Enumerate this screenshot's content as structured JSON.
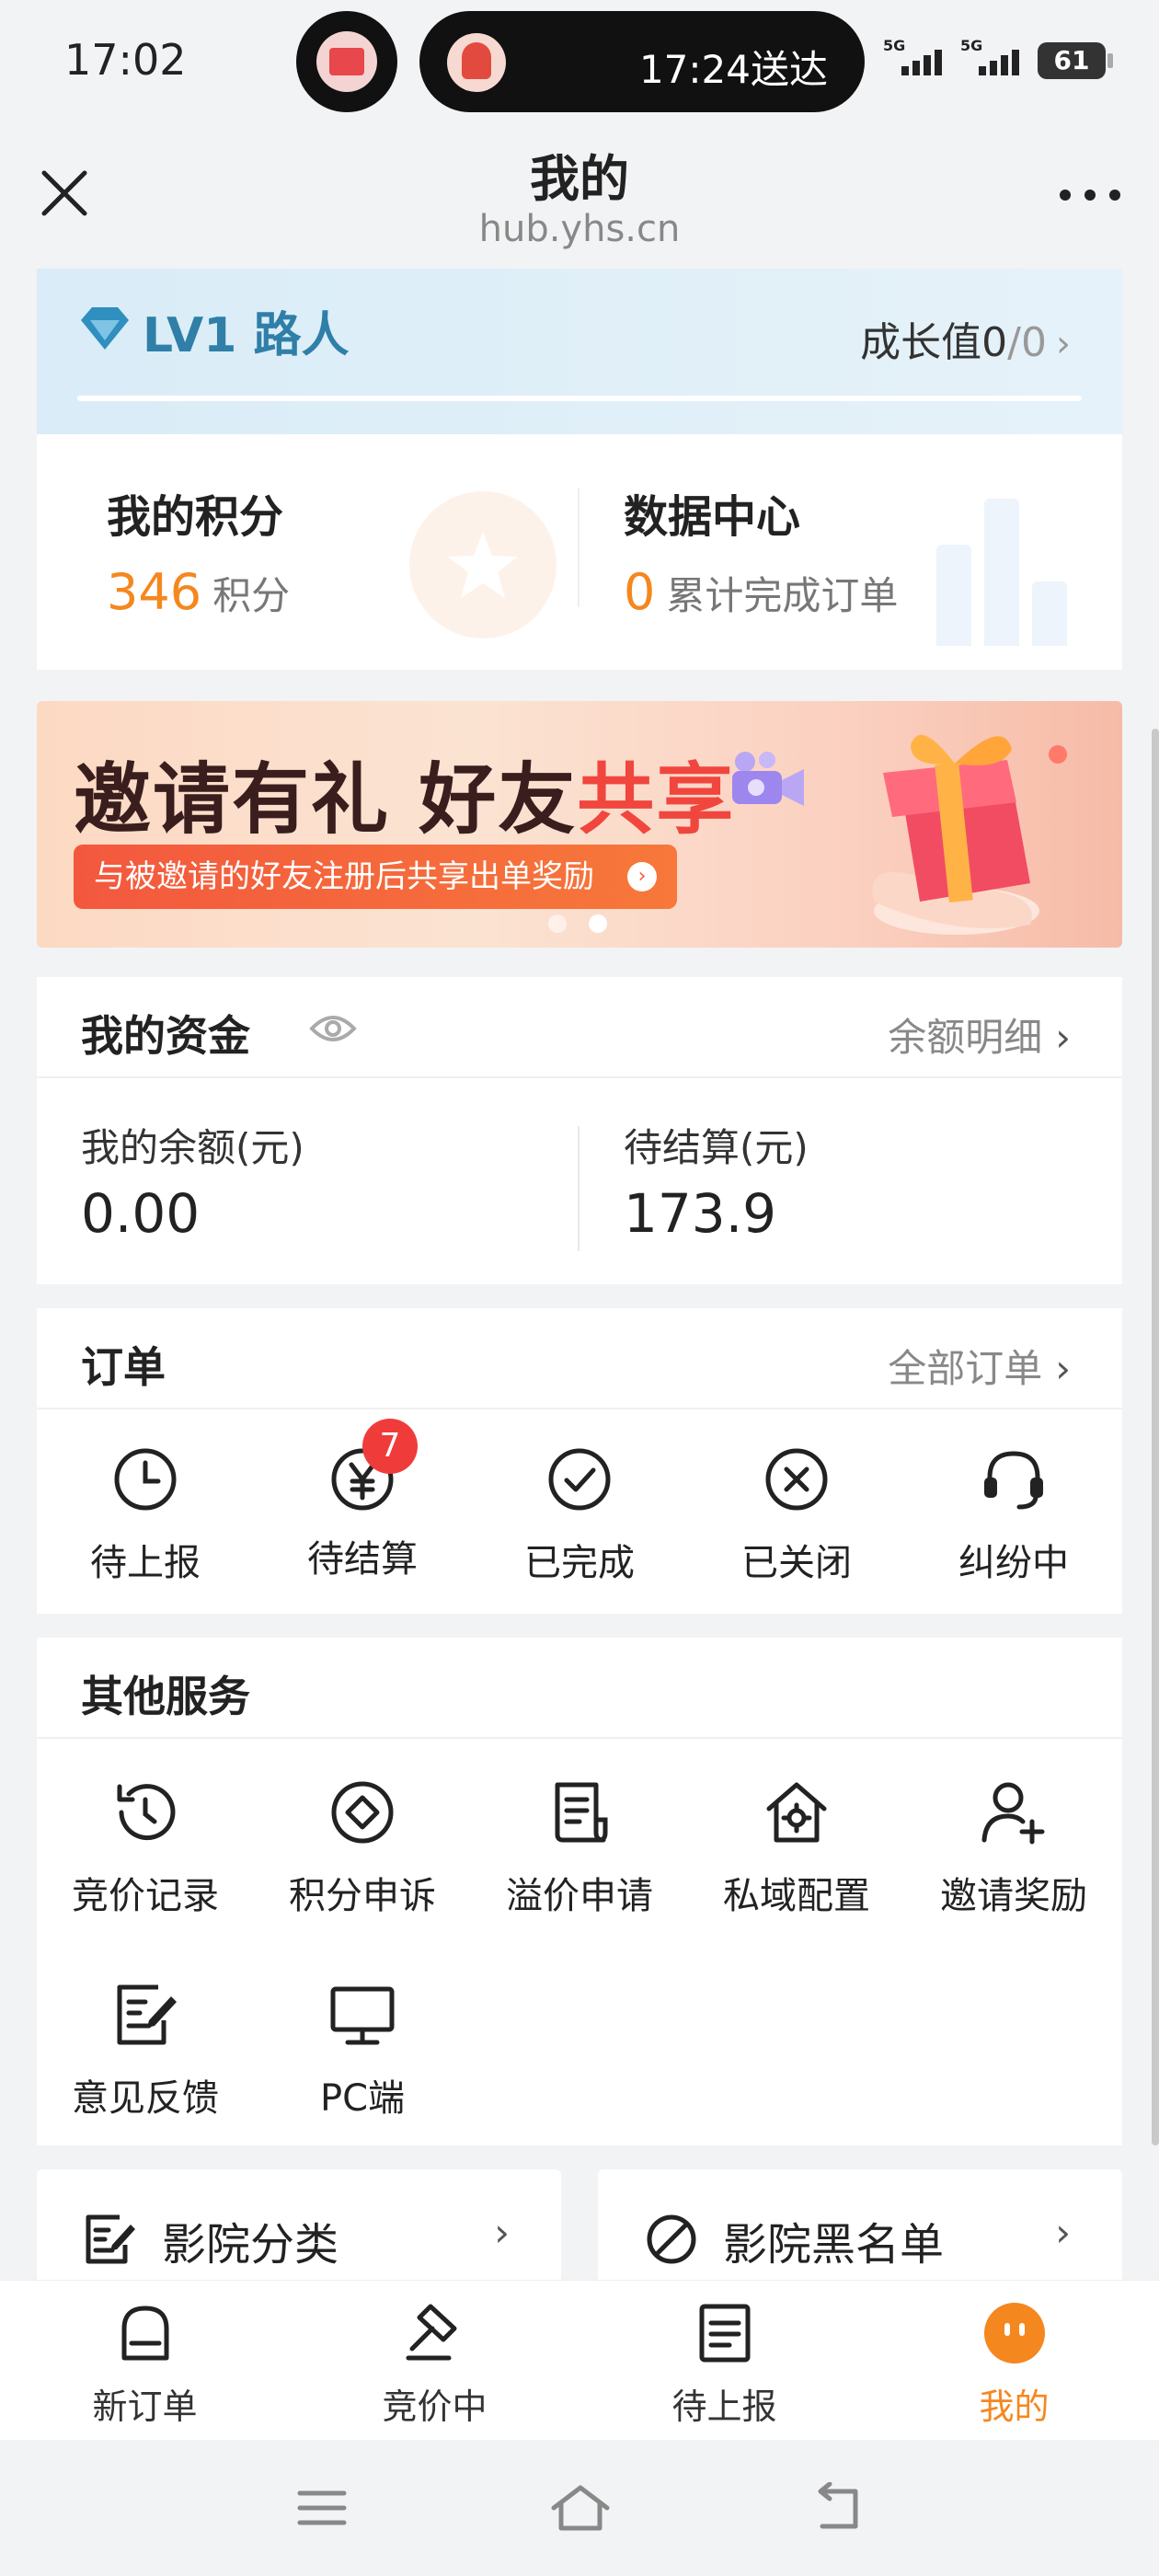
{
  "status_bar": {
    "time": "17:02",
    "live_activity": "17:24送达",
    "signal_1_label": "5G",
    "signal_2_label": "5G",
    "battery": "61"
  },
  "title_bar": {
    "title": "我的",
    "url": "hub.yhs.cn"
  },
  "level": {
    "label": "LV1 路人",
    "growth_label": "成长值",
    "growth_value": "0",
    "growth_max": "/0"
  },
  "points": {
    "points_title": "我的积分",
    "points_value": "346",
    "points_unit": "积分",
    "data_title": "数据中心",
    "data_value": "0",
    "data_unit": "累计完成订单"
  },
  "banner": {
    "headline_a": "邀请有礼 好友",
    "headline_b": "共享",
    "subline": "与被邀请的好友注册后共享出单奖励",
    "slides": 2,
    "active_slide": 2
  },
  "funds": {
    "title": "我的资金",
    "detail_link": "余额明细",
    "balance_label": "我的余额(元)",
    "balance_value": "0.00",
    "pending_label": "待结算(元)",
    "pending_value": "173.9"
  },
  "orders": {
    "title": "订单",
    "all_link": "全部订单",
    "items": [
      {
        "label": "待上报",
        "icon": "clock-icon"
      },
      {
        "label": "待结算",
        "icon": "yen-circle-icon",
        "badge": "7"
      },
      {
        "label": "已完成",
        "icon": "check-circle-icon"
      },
      {
        "label": "已关闭",
        "icon": "x-circle-icon"
      },
      {
        "label": "纠纷中",
        "icon": "headset-icon"
      }
    ]
  },
  "services": {
    "title": "其他服务",
    "items": [
      {
        "label": "竞价记录",
        "icon": "history-icon"
      },
      {
        "label": "积分申诉",
        "icon": "diamond-circle-icon"
      },
      {
        "label": "溢价申请",
        "icon": "document-icon"
      },
      {
        "label": "私域配置",
        "icon": "house-gear-icon"
      },
      {
        "label": "邀请奖励",
        "icon": "user-add-icon"
      },
      {
        "label": "意见反馈",
        "icon": "edit-note-icon"
      },
      {
        "label": "PC端",
        "icon": "monitor-icon"
      }
    ]
  },
  "shortcuts": {
    "cinema_category": "影院分类",
    "cinema_blacklist": "影院黑名单"
  },
  "tabs": [
    {
      "label": "新订单",
      "icon": "inbox-icon"
    },
    {
      "label": "竞价中",
      "icon": "gavel-icon"
    },
    {
      "label": "待上报",
      "icon": "list-doc-icon"
    },
    {
      "label": "我的",
      "icon": "profile-face-icon",
      "active": true
    }
  ],
  "colors": {
    "accent": "#f5871f",
    "badge": "#f03b3b",
    "level_blue": "#2f7fa8",
    "banner_red": "#f0463e"
  }
}
